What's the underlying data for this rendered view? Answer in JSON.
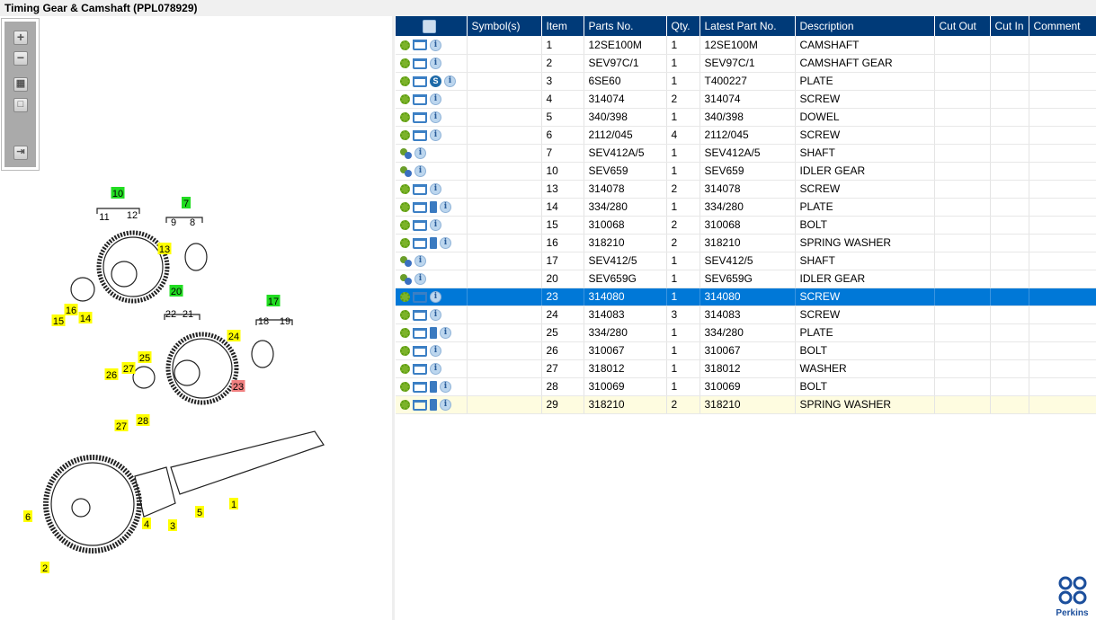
{
  "title": "Timing Gear & Camshaft (PPL078929)",
  "toolbar": {
    "zoom_in": "+",
    "zoom_out": "−",
    "fit": "▦",
    "actual": "□",
    "export": "⇥"
  },
  "table": {
    "headers": [
      "",
      "Symbol(s)",
      "Item",
      "Parts No.",
      "Qty.",
      "Latest Part No.",
      "Description",
      "Cut Out",
      "Cut In",
      "Comment"
    ],
    "rows": [
      {
        "icons": [
          "gear",
          "cart",
          "info"
        ],
        "item": "1",
        "part": "12SE100M",
        "qty": "1",
        "latest": "12SE100M",
        "desc": "CAMSHAFT"
      },
      {
        "icons": [
          "gear",
          "cart",
          "info"
        ],
        "item": "2",
        "part": "SEV97C/1",
        "qty": "1",
        "latest": "SEV97C/1",
        "desc": "CAMSHAFT GEAR"
      },
      {
        "icons": [
          "gear",
          "cart",
          "s",
          "info"
        ],
        "item": "3",
        "part": "6SE60",
        "qty": "1",
        "latest": "T400227",
        "desc": "PLATE"
      },
      {
        "icons": [
          "gear",
          "cart",
          "info"
        ],
        "item": "4",
        "part": "314074",
        "qty": "2",
        "latest": "314074",
        "desc": "SCREW"
      },
      {
        "icons": [
          "gear",
          "cart",
          "info"
        ],
        "item": "5",
        "part": "340/398",
        "qty": "1",
        "latest": "340/398",
        "desc": "DOWEL"
      },
      {
        "icons": [
          "gear",
          "cart",
          "info"
        ],
        "item": "6",
        "part": "2112/045",
        "qty": "4",
        "latest": "2112/045",
        "desc": "SCREW"
      },
      {
        "icons": [
          "gears",
          "info"
        ],
        "item": "7",
        "part": "SEV412A/5",
        "qty": "1",
        "latest": "SEV412A/5",
        "desc": "SHAFT"
      },
      {
        "icons": [
          "gears",
          "info"
        ],
        "item": "10",
        "part": "SEV659",
        "qty": "1",
        "latest": "SEV659",
        "desc": "IDLER GEAR"
      },
      {
        "icons": [
          "gear",
          "cart",
          "info"
        ],
        "item": "13",
        "part": "314078",
        "qty": "2",
        "latest": "314078",
        "desc": "SCREW"
      },
      {
        "icons": [
          "gear",
          "cart",
          "book",
          "info"
        ],
        "item": "14",
        "part": "334/280",
        "qty": "1",
        "latest": "334/280",
        "desc": "PLATE"
      },
      {
        "icons": [
          "gear",
          "cart",
          "info"
        ],
        "item": "15",
        "part": "310068",
        "qty": "2",
        "latest": "310068",
        "desc": "BOLT"
      },
      {
        "icons": [
          "gear",
          "cart",
          "book",
          "info"
        ],
        "item": "16",
        "part": "318210",
        "qty": "2",
        "latest": "318210",
        "desc": "SPRING WASHER"
      },
      {
        "icons": [
          "gears",
          "info"
        ],
        "item": "17",
        "part": "SEV412/5",
        "qty": "1",
        "latest": "SEV412/5",
        "desc": "SHAFT"
      },
      {
        "icons": [
          "gears",
          "info"
        ],
        "item": "20",
        "part": "SEV659G",
        "qty": "1",
        "latest": "SEV659G",
        "desc": "IDLER GEAR"
      },
      {
        "icons": [
          "gear",
          "cart",
          "info"
        ],
        "item": "23",
        "part": "314080",
        "qty": "1",
        "latest": "314080",
        "desc": "SCREW",
        "selected": true
      },
      {
        "icons": [
          "gear",
          "cart",
          "info"
        ],
        "item": "24",
        "part": "314083",
        "qty": "3",
        "latest": "314083",
        "desc": "SCREW"
      },
      {
        "icons": [
          "gear",
          "cart",
          "book",
          "info"
        ],
        "item": "25",
        "part": "334/280",
        "qty": "1",
        "latest": "334/280",
        "desc": "PLATE"
      },
      {
        "icons": [
          "gear",
          "cart",
          "info"
        ],
        "item": "26",
        "part": "310067",
        "qty": "1",
        "latest": "310067",
        "desc": "BOLT"
      },
      {
        "icons": [
          "gear",
          "cart",
          "info"
        ],
        "item": "27",
        "part": "318012",
        "qty": "1",
        "latest": "318012",
        "desc": "WASHER"
      },
      {
        "icons": [
          "gear",
          "cart",
          "book",
          "info"
        ],
        "item": "28",
        "part": "310069",
        "qty": "1",
        "latest": "310069",
        "desc": "BOLT"
      },
      {
        "icons": [
          "gear",
          "cart",
          "book",
          "info"
        ],
        "item": "29",
        "part": "318210",
        "qty": "2",
        "latest": "318210",
        "desc": "SPRING WASHER",
        "hover": true
      }
    ]
  },
  "diagram": {
    "callouts": [
      {
        "t": "10",
        "c": "green"
      },
      {
        "t": "11",
        "c": "none"
      },
      {
        "t": "12",
        "c": "none"
      },
      {
        "t": "7",
        "c": "green"
      },
      {
        "t": "9",
        "c": "none"
      },
      {
        "t": "8",
        "c": "none"
      },
      {
        "t": "13",
        "c": "yellow"
      },
      {
        "t": "15",
        "c": "yellow"
      },
      {
        "t": "16",
        "c": "yellow"
      },
      {
        "t": "14",
        "c": "yellow"
      },
      {
        "t": "20",
        "c": "green"
      },
      {
        "t": "22",
        "c": "none"
      },
      {
        "t": "21",
        "c": "none"
      },
      {
        "t": "17",
        "c": "green"
      },
      {
        "t": "18",
        "c": "none"
      },
      {
        "t": "19",
        "c": "none"
      },
      {
        "t": "24",
        "c": "yellow"
      },
      {
        "t": "23",
        "c": "red"
      },
      {
        "t": "25",
        "c": "yellow"
      },
      {
        "t": "26",
        "c": "yellow"
      },
      {
        "t": "27",
        "c": "yellow"
      },
      {
        "t": "27",
        "c": "yellow"
      },
      {
        "t": "28",
        "c": "yellow"
      },
      {
        "t": "6",
        "c": "yellow"
      },
      {
        "t": "4",
        "c": "yellow"
      },
      {
        "t": "3",
        "c": "yellow"
      },
      {
        "t": "5",
        "c": "yellow"
      },
      {
        "t": "1",
        "c": "yellow"
      },
      {
        "t": "2",
        "c": "yellow"
      }
    ],
    "colors": {
      "green": "#22dd22",
      "yellow": "#ffff00",
      "red": "#f08080"
    }
  },
  "logo": "Perkins"
}
